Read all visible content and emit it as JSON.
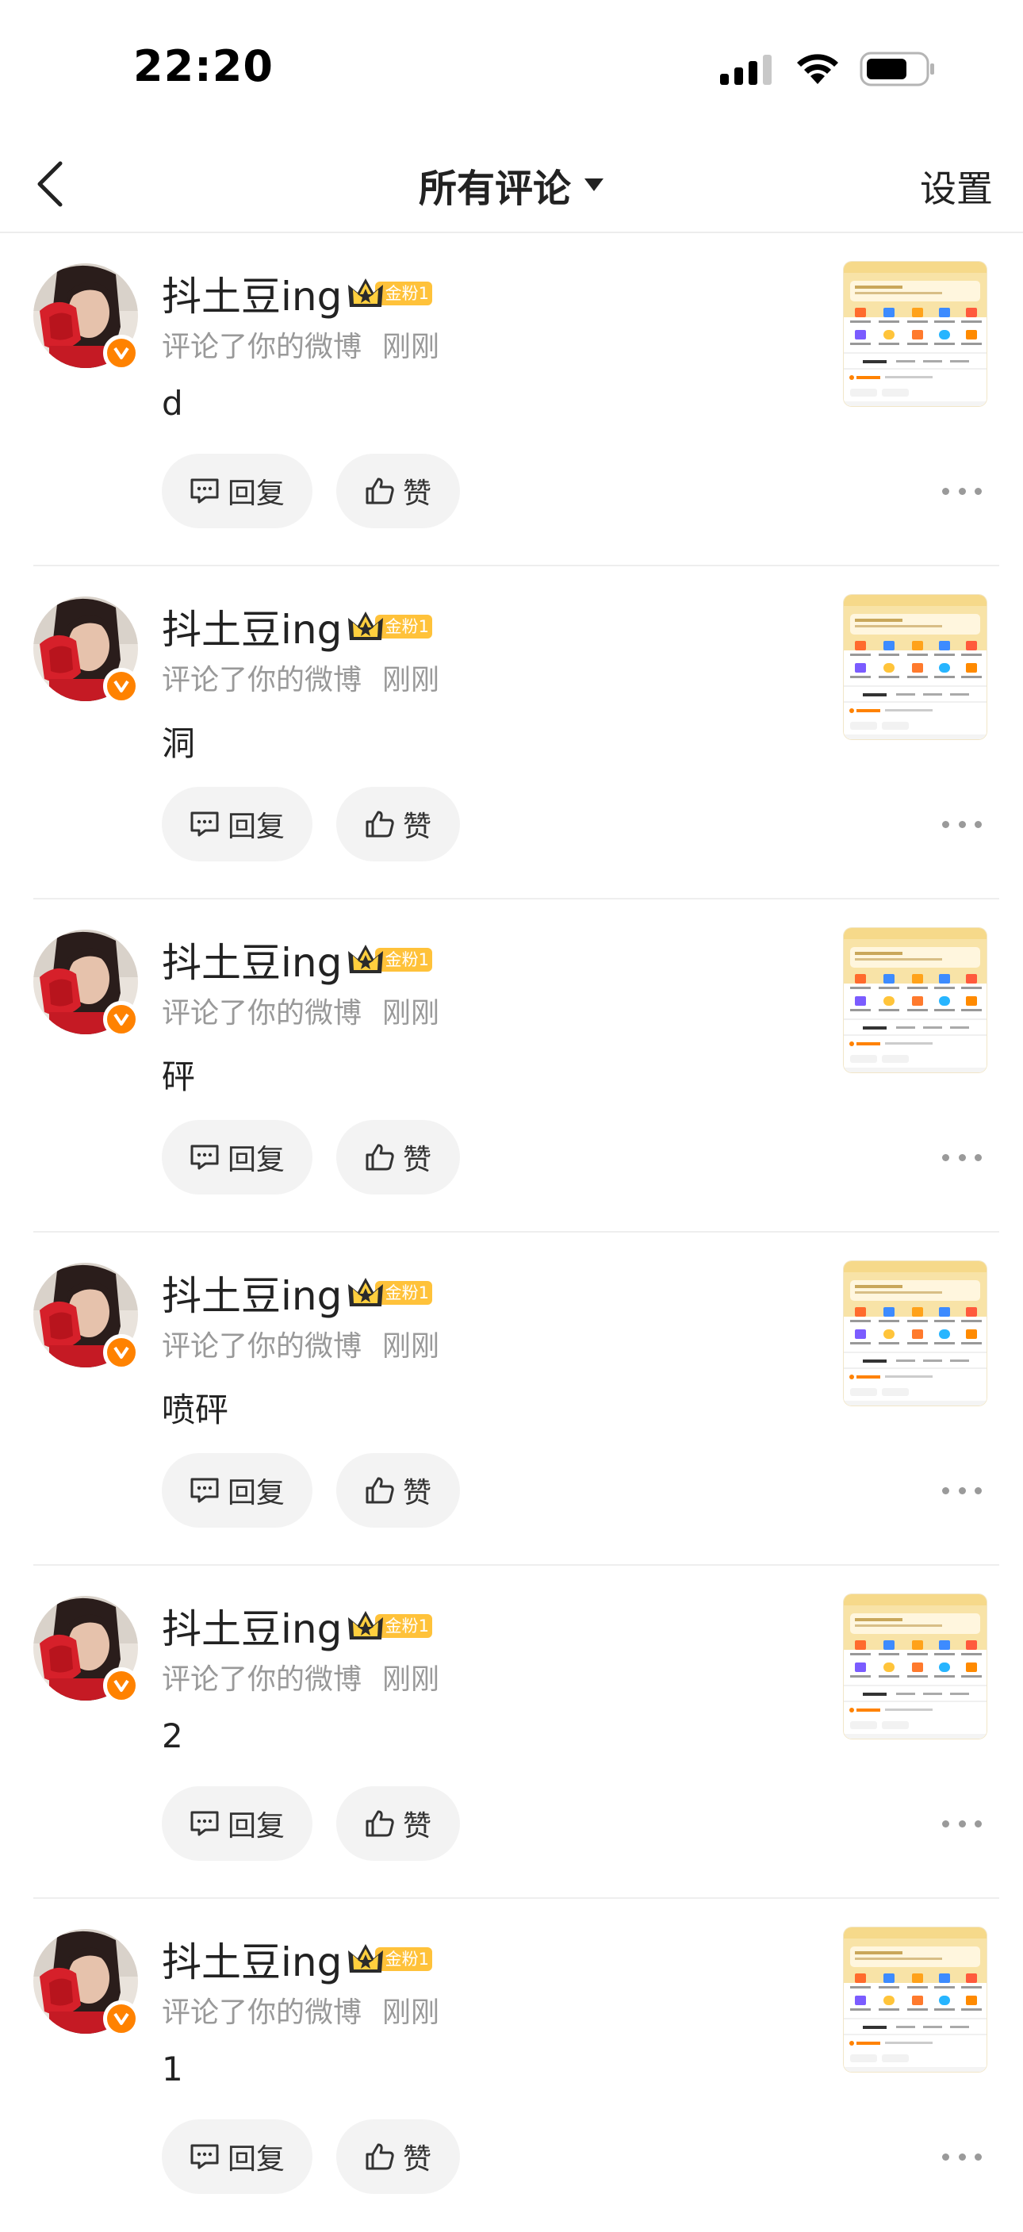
{
  "status_bar": {
    "time": "22:20",
    "icons": [
      "signal-icon",
      "wifi-icon",
      "battery-icon"
    ]
  },
  "nav": {
    "back_icon": "back-arrow-icon",
    "title": "所有评论",
    "dropdown_icon": "caret-down-icon",
    "settings_label": "设置"
  },
  "comments": [
    {
      "username": "抖土豆ing",
      "badge": "金粉1",
      "meta": "评论了你的微博",
      "time": "刚刚",
      "content": "d",
      "reply_label": "回复",
      "like_label": "赞"
    },
    {
      "username": "抖土豆ing",
      "badge": "金粉1",
      "meta": "评论了你的微博",
      "time": "刚刚",
      "content": "洞",
      "reply_label": "回复",
      "like_label": "赞"
    },
    {
      "username": "抖土豆ing",
      "badge": "金粉1",
      "meta": "评论了你的微博",
      "time": "刚刚",
      "content": "砰",
      "reply_label": "回复",
      "like_label": "赞"
    },
    {
      "username": "抖土豆ing",
      "badge": "金粉1",
      "meta": "评论了你的微博",
      "time": "刚刚",
      "content": "喷砰",
      "reply_label": "回复",
      "like_label": "赞"
    },
    {
      "username": "抖土豆ing",
      "badge": "金粉1",
      "meta": "评论了你的微博",
      "time": "刚刚",
      "content": "2",
      "reply_label": "回复",
      "like_label": "赞"
    },
    {
      "username": "抖土豆ing",
      "badge": "金粉1",
      "meta": "评论了你的微博",
      "time": "刚刚",
      "content": "1",
      "reply_label": "回复",
      "like_label": "赞"
    }
  ],
  "colors": {
    "accent": "#ff8200",
    "badge_gold": "#ffc23a",
    "pill_bg": "#f3f3f3",
    "meta_text": "#999999"
  }
}
